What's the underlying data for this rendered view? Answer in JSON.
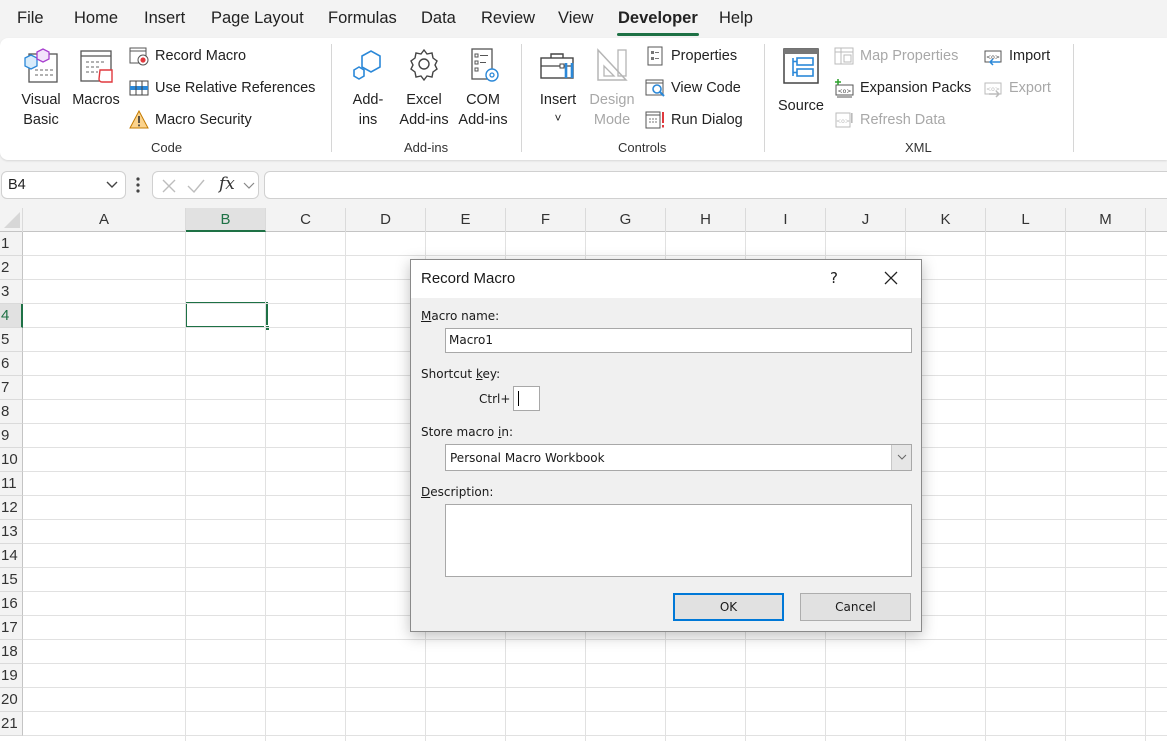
{
  "menu": {
    "tabs": [
      {
        "label": "File"
      },
      {
        "label": "Home"
      },
      {
        "label": "Insert"
      },
      {
        "label": "Page Layout"
      },
      {
        "label": "Formulas"
      },
      {
        "label": "Data"
      },
      {
        "label": "Review"
      },
      {
        "label": "View"
      },
      {
        "label": "Developer",
        "active": true
      },
      {
        "label": "Help"
      }
    ]
  },
  "ribbon": {
    "code": {
      "label": "Code",
      "visual_basic": [
        "Visual",
        "Basic"
      ],
      "macros": "Macros",
      "record_macro": "Record Macro",
      "use_relative_references": "Use Relative References",
      "macro_security": "Macro Security"
    },
    "addins": {
      "label": "Add-ins",
      "add_ins": [
        "Add-",
        "ins"
      ],
      "excel_add_ins": [
        "Excel",
        "Add-ins"
      ],
      "com_add_ins": [
        "COM",
        "Add-ins"
      ]
    },
    "controls": {
      "label": "Controls",
      "insert": "Insert",
      "insert_chevron": "˅",
      "design_mode": [
        "Design",
        "Mode"
      ],
      "properties": "Properties",
      "view_code": "View Code",
      "run_dialog": "Run Dialog"
    },
    "xml": {
      "label": "XML",
      "source": "Source",
      "map_properties": "Map Properties",
      "expansion_packs": "Expansion Packs",
      "refresh_data": "Refresh Data",
      "import": "Import",
      "export": "Export"
    }
  },
  "formula_bar": {
    "name_box": "B4",
    "formula": ""
  },
  "grid": {
    "columns": [
      "A",
      "B",
      "C",
      "D",
      "E",
      "F",
      "G",
      "H",
      "I",
      "J",
      "K",
      "L",
      "M"
    ],
    "rows": [
      "1",
      "2",
      "3",
      "4",
      "5",
      "6",
      "7",
      "8",
      "9",
      "10",
      "11",
      "12",
      "13",
      "14",
      "15",
      "16",
      "17",
      "18",
      "19",
      "20",
      "21"
    ],
    "selected_column": "B",
    "selected_row": "4",
    "active_cell": "B4"
  },
  "dialog": {
    "title": "Record Macro",
    "help": "?",
    "macro_name_label": {
      "accel": "M",
      "rest": "acro name:"
    },
    "macro_name_value": "Macro1",
    "shortcut_label": {
      "pre": "Shortcut ",
      "accel": "k",
      "rest": "ey:"
    },
    "ctrl_label": "Ctrl+",
    "shortcut_value": "",
    "store_label": {
      "pre": "Store macro ",
      "accel": "i",
      "rest": "n:"
    },
    "store_value": "Personal Macro Workbook",
    "description_label": {
      "accel": "D",
      "rest": "escription:"
    },
    "description_value": "",
    "ok": "OK",
    "cancel": "Cancel"
  },
  "colors": {
    "accent_green": "#1e7145",
    "focus_blue": "#0078d7"
  }
}
